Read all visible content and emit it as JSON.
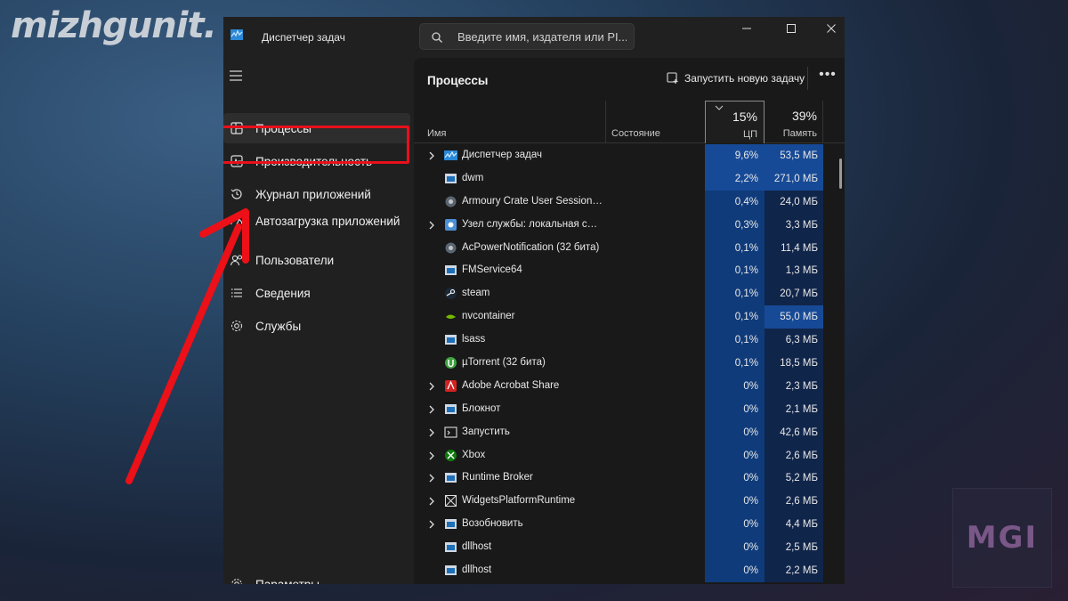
{
  "watermark": {
    "logo_text": "mizhgunit.",
    "badge_text": "MGI"
  },
  "window": {
    "title": "Диспетчер задач",
    "search_placeholder": "Введите имя, издателя или PI...",
    "controls": {
      "minimize": "minimize-icon",
      "maximize": "maximize-icon",
      "close": "close-icon"
    }
  },
  "sidebar": {
    "items": [
      {
        "label": "Процессы",
        "icon": "processes-icon",
        "selected": true
      },
      {
        "label": "Производительность",
        "icon": "performance-icon",
        "selected": false
      },
      {
        "label": "Журнал приложений",
        "icon": "history-icon",
        "selected": false
      },
      {
        "label": "Автозагрузка приложений",
        "icon": "startup-icon",
        "selected": false
      },
      {
        "label": "Пользователи",
        "icon": "users-icon",
        "selected": false
      },
      {
        "label": "Сведения",
        "icon": "details-icon",
        "selected": false
      },
      {
        "label": "Службы",
        "icon": "services-icon",
        "selected": false
      }
    ],
    "settings_label": "Параметры"
  },
  "main": {
    "title": "Процессы",
    "run_new_task": "Запустить новую задачу",
    "more": "•••",
    "columns": {
      "name": "Имя",
      "state": "Состояние",
      "cpu_pct": "15%",
      "cpu_label": "ЦП",
      "mem_pct": "39%",
      "mem_label": "Память"
    },
    "processes": [
      {
        "name": "Диспетчер задач",
        "cpu": "9,6%",
        "mem": "53,5 МБ",
        "expandable": true,
        "icon": "taskmgr"
      },
      {
        "name": "dwm",
        "cpu": "2,2%",
        "mem": "271,0 МБ",
        "expandable": false,
        "icon": "window"
      },
      {
        "name": "Armoury Crate User Session H...",
        "cpu": "0,4%",
        "mem": "24,0 МБ",
        "expandable": false,
        "icon": "gear"
      },
      {
        "name": "Узел службы: локальная служ...",
        "cpu": "0,3%",
        "mem": "3,3 МБ",
        "expandable": true,
        "icon": "cog"
      },
      {
        "name": "AcPowerNotification (32 бита)",
        "cpu": "0,1%",
        "mem": "11,4 МБ",
        "expandable": false,
        "icon": "gear"
      },
      {
        "name": "FMService64",
        "cpu": "0,1%",
        "mem": "1,3 МБ",
        "expandable": false,
        "icon": "window"
      },
      {
        "name": "steam",
        "cpu": "0,1%",
        "mem": "20,7 МБ",
        "expandable": false,
        "icon": "steam"
      },
      {
        "name": "nvcontainer",
        "cpu": "0,1%",
        "mem": "55,0 МБ",
        "expandable": false,
        "icon": "nvidia"
      },
      {
        "name": "lsass",
        "cpu": "0,1%",
        "mem": "6,3 МБ",
        "expandable": false,
        "icon": "window"
      },
      {
        "name": "µTorrent (32 бита)",
        "cpu": "0,1%",
        "mem": "18,5 МБ",
        "expandable": false,
        "icon": "utorrent"
      },
      {
        "name": "Adobe Acrobat Share",
        "cpu": "0%",
        "mem": "2,3 МБ",
        "expandable": true,
        "icon": "acrobat"
      },
      {
        "name": "Блокнот",
        "cpu": "0%",
        "mem": "2,1 МБ",
        "expandable": true,
        "icon": "window"
      },
      {
        "name": "Запустить",
        "cpu": "0%",
        "mem": "42,6 МБ",
        "expandable": true,
        "icon": "run"
      },
      {
        "name": "Xbox",
        "cpu": "0%",
        "mem": "2,6 МБ",
        "expandable": true,
        "icon": "xbox"
      },
      {
        "name": "Runtime Broker",
        "cpu": "0%",
        "mem": "5,2 МБ",
        "expandable": true,
        "icon": "window"
      },
      {
        "name": "WidgetsPlatformRuntime",
        "cpu": "0%",
        "mem": "2,6 МБ",
        "expandable": true,
        "icon": "widgets"
      },
      {
        "name": "Возобновить",
        "cpu": "0%",
        "mem": "4,4 МБ",
        "expandable": true,
        "icon": "window"
      },
      {
        "name": "dllhost",
        "cpu": "0%",
        "mem": "2,5 МБ",
        "expandable": false,
        "icon": "window"
      },
      {
        "name": "dllhost",
        "cpu": "0%",
        "mem": "2,2 МБ",
        "expandable": false,
        "icon": "window"
      }
    ]
  },
  "colors": {
    "cpu_cell": "#0f3b7a",
    "cpu_cell_hot": "#174a96",
    "mem_cell": "#10254a",
    "mem_cell_hot": "#174a96",
    "highlight": "#e8101a"
  }
}
